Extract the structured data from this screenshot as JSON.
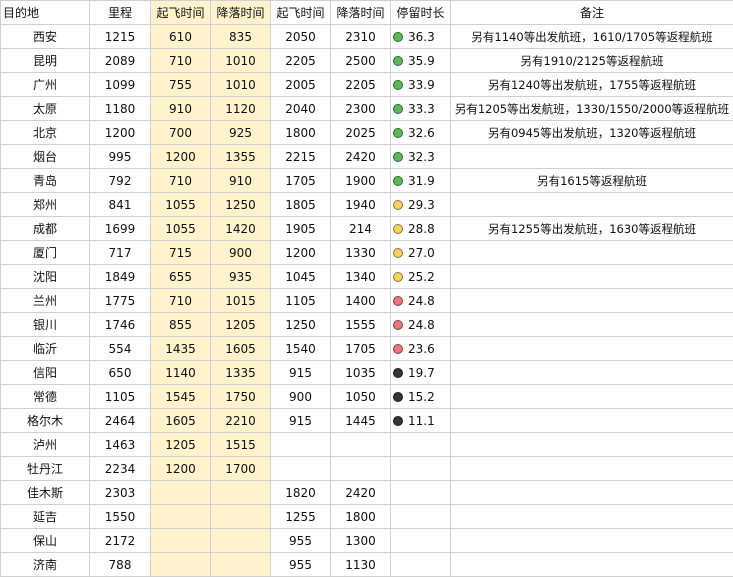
{
  "columns": [
    "目的地",
    "里程",
    "起飞时间",
    "降落时间",
    "起飞时间",
    "降落时间",
    "停留时长",
    "备注"
  ],
  "colors": {
    "highlight": "#fff2cc",
    "green": "#5cb85c",
    "yellow": "#f4d35e",
    "red": "#e8787a",
    "black": "#333333"
  },
  "rows": [
    {
      "dest": "西安",
      "miles": "1215",
      "dep1": "610",
      "arr1": "835",
      "dep2": "2050",
      "arr2": "2310",
      "stay": "36.3",
      "icon": "green",
      "note": "另有1140等出发航班，1610/1705等返程航班"
    },
    {
      "dest": "昆明",
      "miles": "2089",
      "dep1": "710",
      "arr1": "1010",
      "dep2": "2205",
      "arr2": "2500",
      "stay": "35.9",
      "icon": "green",
      "note": "另有1910/2125等返程航班"
    },
    {
      "dest": "广州",
      "miles": "1099",
      "dep1": "755",
      "arr1": "1010",
      "dep2": "2005",
      "arr2": "2205",
      "stay": "33.9",
      "icon": "green",
      "note": "另有1240等出发航班，1755等返程航班"
    },
    {
      "dest": "太原",
      "miles": "1180",
      "dep1": "910",
      "arr1": "1120",
      "dep2": "2040",
      "arr2": "2300",
      "stay": "33.3",
      "icon": "green",
      "note": "另有1205等出发航班，1330/1550/2000等返程航班"
    },
    {
      "dest": "北京",
      "miles": "1200",
      "dep1": "700",
      "arr1": "925",
      "dep2": "1800",
      "arr2": "2025",
      "stay": "32.6",
      "icon": "green",
      "note": "另有0945等出发航班，1320等返程航班"
    },
    {
      "dest": "烟台",
      "miles": "995",
      "dep1": "1200",
      "arr1": "1355",
      "dep2": "2215",
      "arr2": "2420",
      "stay": "32.3",
      "icon": "green",
      "note": ""
    },
    {
      "dest": "青岛",
      "miles": "792",
      "dep1": "710",
      "arr1": "910",
      "dep2": "1705",
      "arr2": "1900",
      "stay": "31.9",
      "icon": "green",
      "note": "另有1615等返程航班"
    },
    {
      "dest": "郑州",
      "miles": "841",
      "dep1": "1055",
      "arr1": "1250",
      "dep2": "1805",
      "arr2": "1940",
      "stay": "29.3",
      "icon": "yellow",
      "note": ""
    },
    {
      "dest": "成都",
      "miles": "1699",
      "dep1": "1055",
      "arr1": "1420",
      "dep2": "1905",
      "arr2": "214",
      "stay": "28.8",
      "icon": "yellow",
      "note": "另有1255等出发航班，1630等返程航班"
    },
    {
      "dest": "厦门",
      "miles": "717",
      "dep1": "715",
      "arr1": "900",
      "dep2": "1200",
      "arr2": "1330",
      "stay": "27.0",
      "icon": "yellow",
      "note": ""
    },
    {
      "dest": "沈阳",
      "miles": "1849",
      "dep1": "655",
      "arr1": "935",
      "dep2": "1045",
      "arr2": "1340",
      "stay": "25.2",
      "icon": "yellow",
      "note": ""
    },
    {
      "dest": "兰州",
      "miles": "1775",
      "dep1": "710",
      "arr1": "1015",
      "dep2": "1105",
      "arr2": "1400",
      "stay": "24.8",
      "icon": "red",
      "note": ""
    },
    {
      "dest": "银川",
      "miles": "1746",
      "dep1": "855",
      "arr1": "1205",
      "dep2": "1250",
      "arr2": "1555",
      "stay": "24.8",
      "icon": "red",
      "note": ""
    },
    {
      "dest": "临沂",
      "miles": "554",
      "dep1": "1435",
      "arr1": "1605",
      "dep2": "1540",
      "arr2": "1705",
      "stay": "23.6",
      "icon": "red",
      "note": ""
    },
    {
      "dest": "信阳",
      "miles": "650",
      "dep1": "1140",
      "arr1": "1335",
      "dep2": "915",
      "arr2": "1035",
      "stay": "19.7",
      "icon": "black",
      "note": ""
    },
    {
      "dest": "常德",
      "miles": "1105",
      "dep1": "1545",
      "arr1": "1750",
      "dep2": "900",
      "arr2": "1050",
      "stay": "15.2",
      "icon": "black",
      "note": ""
    },
    {
      "dest": "格尔木",
      "miles": "2464",
      "dep1": "1605",
      "arr1": "2210",
      "dep2": "915",
      "arr2": "1445",
      "stay": "11.1",
      "icon": "black",
      "note": ""
    },
    {
      "dest": "泸州",
      "miles": "1463",
      "dep1": "1205",
      "arr1": "1515",
      "dep2": "",
      "arr2": "",
      "stay": "",
      "icon": "",
      "note": ""
    },
    {
      "dest": "牡丹江",
      "miles": "2234",
      "dep1": "1200",
      "arr1": "1700",
      "dep2": "",
      "arr2": "",
      "stay": "",
      "icon": "",
      "note": ""
    },
    {
      "dest": "佳木斯",
      "miles": "2303",
      "dep1": "",
      "arr1": "",
      "dep2": "1820",
      "arr2": "2420",
      "stay": "",
      "icon": "",
      "note": ""
    },
    {
      "dest": "延吉",
      "miles": "1550",
      "dep1": "",
      "arr1": "",
      "dep2": "1255",
      "arr2": "1800",
      "stay": "",
      "icon": "",
      "note": ""
    },
    {
      "dest": "保山",
      "miles": "2172",
      "dep1": "",
      "arr1": "",
      "dep2": "955",
      "arr2": "1300",
      "stay": "",
      "icon": "",
      "note": ""
    },
    {
      "dest": "济南",
      "miles": "788",
      "dep1": "",
      "arr1": "",
      "dep2": "955",
      "arr2": "1130",
      "stay": "",
      "icon": "",
      "note": ""
    }
  ]
}
